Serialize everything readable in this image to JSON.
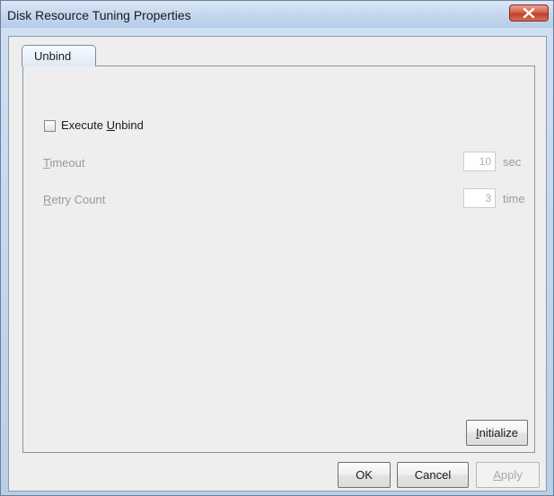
{
  "window": {
    "title": "Disk Resource Tuning Properties"
  },
  "tabs": [
    {
      "label": "Unbind",
      "selected": true
    }
  ],
  "unbind": {
    "execute_checkbox": {
      "label_prefix": "Execute ",
      "label_mnemonic": "U",
      "label_suffix": "nbind",
      "checked": false
    },
    "timeout": {
      "label_mnemonic": "T",
      "label_suffix": "imeout",
      "value": "10",
      "unit": "sec"
    },
    "retry_count": {
      "label_mnemonic": "R",
      "label_suffix": "etry Count",
      "value": "3",
      "unit": "time"
    },
    "initialize_button": {
      "label_mnemonic": "I",
      "label_suffix": "nitialize"
    }
  },
  "footer": {
    "ok_label": "OK",
    "cancel_label": "Cancel",
    "apply_mnemonic": "A",
    "apply_suffix": "pply"
  },
  "icons": {
    "close": "close-icon"
  },
  "colors": {
    "title_bar": "#c4d7ee",
    "close_button": "#c2412b",
    "panel_background": "#eeeeee",
    "disabled_text": "#9a9a9a"
  }
}
